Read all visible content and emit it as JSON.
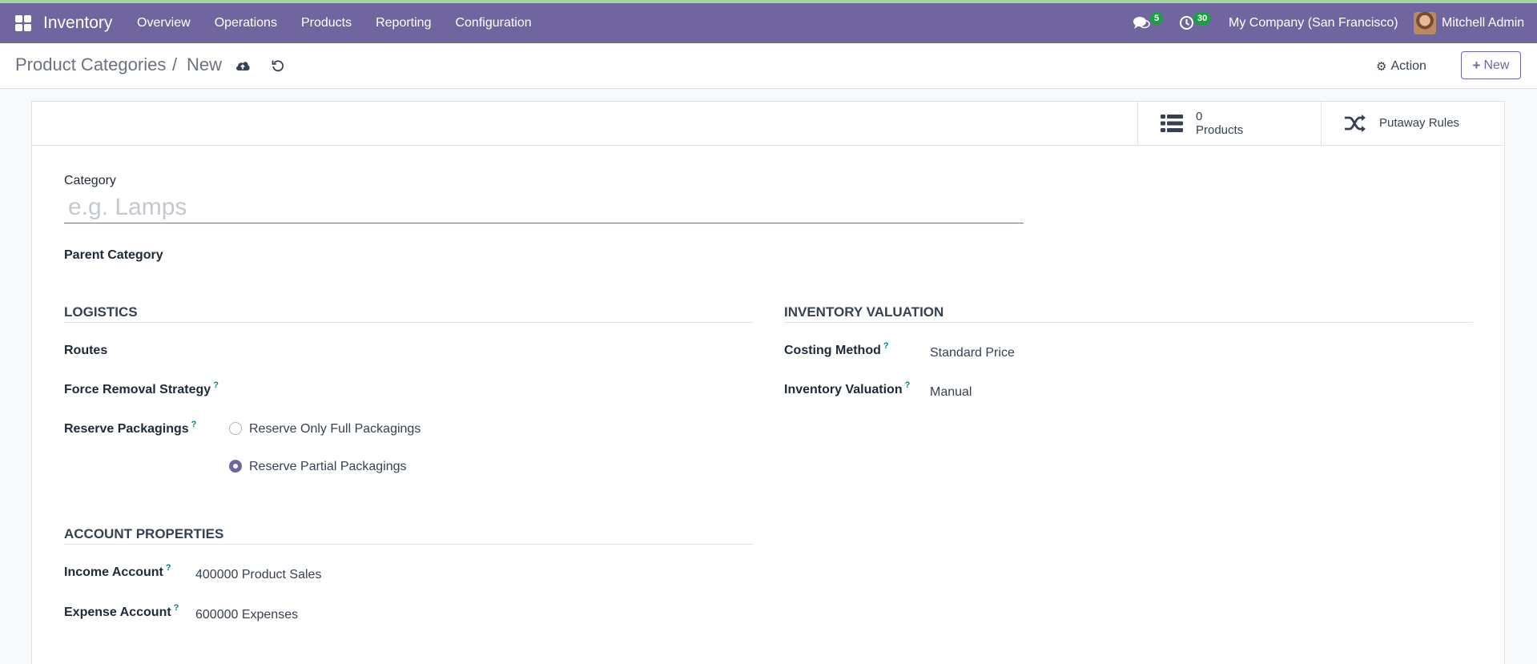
{
  "navbar": {
    "app_name": "Inventory",
    "menu": [
      "Overview",
      "Operations",
      "Products",
      "Reporting",
      "Configuration"
    ],
    "messages_count": "5",
    "activities_count": "30",
    "company": "My Company (San Francisco)",
    "user": "Mitchell Admin",
    "colors": {
      "bar": "#7165a0",
      "badge": "#1e9e44"
    }
  },
  "breadcrumb": {
    "parent": "Product Categories",
    "separator": "/",
    "current": "New"
  },
  "controls": {
    "action_label": "Action",
    "new_label": "New"
  },
  "buttonbox": {
    "products_count": "0",
    "products_label": "Products",
    "putaway_label": "Putaway Rules"
  },
  "form": {
    "category_label": "Category",
    "category_placeholder": "e.g. Lamps",
    "parent_category_label": "Parent Category",
    "logistics": {
      "title": "LOGISTICS",
      "routes_label": "Routes",
      "removal_label": "Force Removal Strategy",
      "reserve_label": "Reserve Packagings",
      "reserve_options": [
        {
          "label": "Reserve Only Full Packagings",
          "checked": false
        },
        {
          "label": "Reserve Partial Packagings",
          "checked": true
        }
      ]
    },
    "valuation": {
      "title": "INVENTORY VALUATION",
      "costing_label": "Costing Method",
      "costing_value": "Standard Price",
      "valuation_label": "Inventory Valuation",
      "valuation_value": "Manual"
    },
    "accounts": {
      "title": "ACCOUNT PROPERTIES",
      "income_label": "Income Account",
      "income_value": "400000 Product Sales",
      "expense_label": "Expense Account",
      "expense_value": "600000 Expenses"
    },
    "help_mark": "?"
  }
}
